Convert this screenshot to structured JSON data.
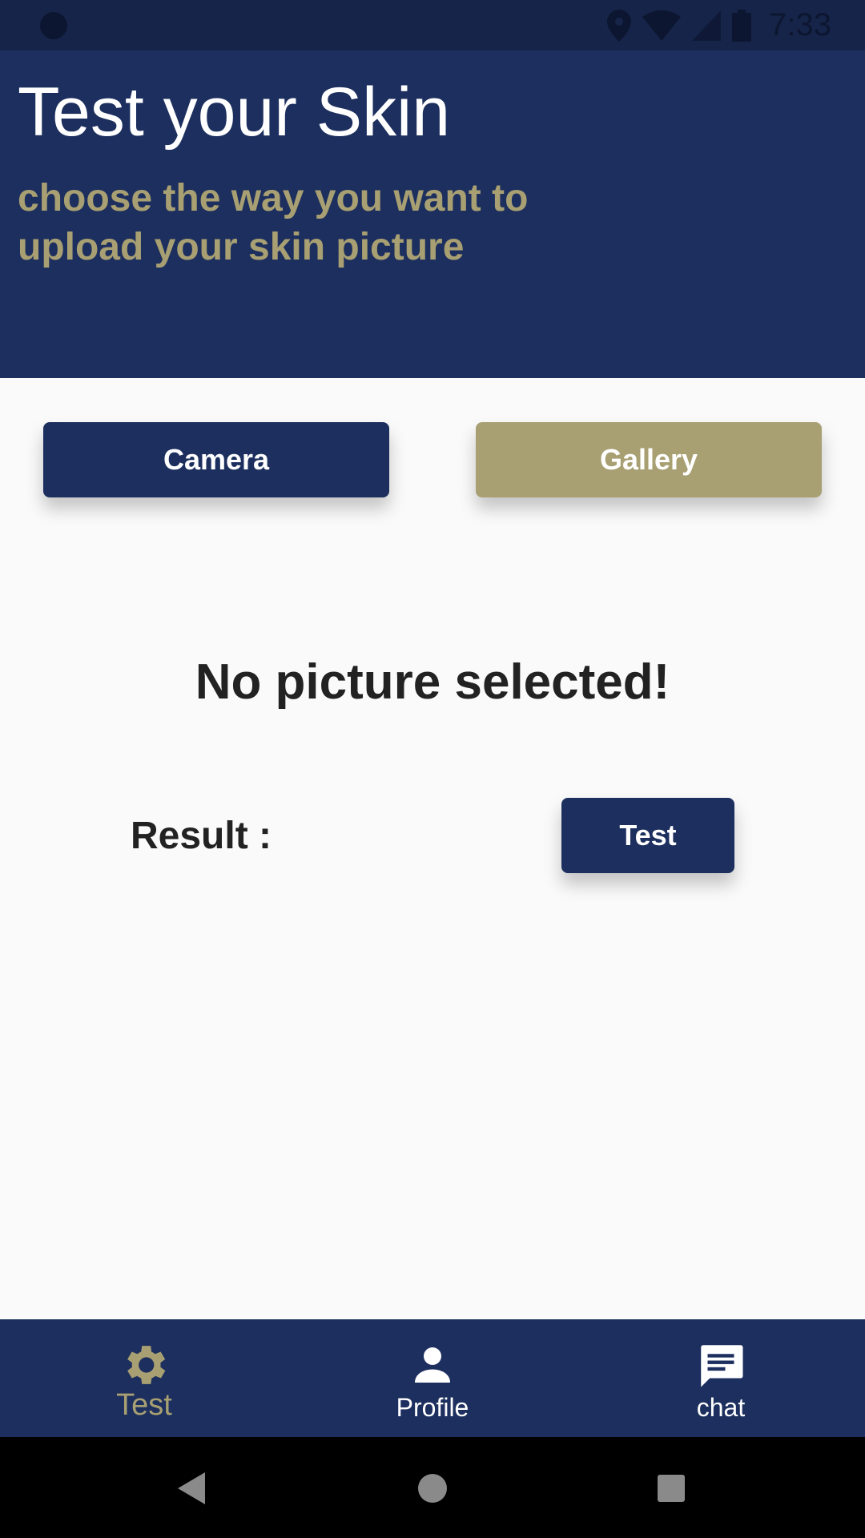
{
  "status_bar": {
    "time": "7:33",
    "icons": [
      "location-icon",
      "wifi-icon",
      "signal-icon",
      "battery-icon"
    ]
  },
  "header": {
    "title": "Test your Skin",
    "subtitle": "choose the way you want to upload your skin picture"
  },
  "actions": {
    "camera_label": "Camera",
    "gallery_label": "Gallery"
  },
  "preview": {
    "empty_text": "No picture selected!"
  },
  "result": {
    "label": "Result :",
    "test_label": "Test"
  },
  "bottom_nav": {
    "items": [
      {
        "label": "Test",
        "icon": "gear-icon",
        "active": true
      },
      {
        "label": "Profile",
        "icon": "person-icon",
        "active": false
      },
      {
        "label": "chat",
        "icon": "chat-icon",
        "active": false
      }
    ]
  },
  "colors": {
    "primary": "#1c2f5e",
    "accent": "#a89f72",
    "background": "#fafafa",
    "text_dark": "#222222"
  }
}
